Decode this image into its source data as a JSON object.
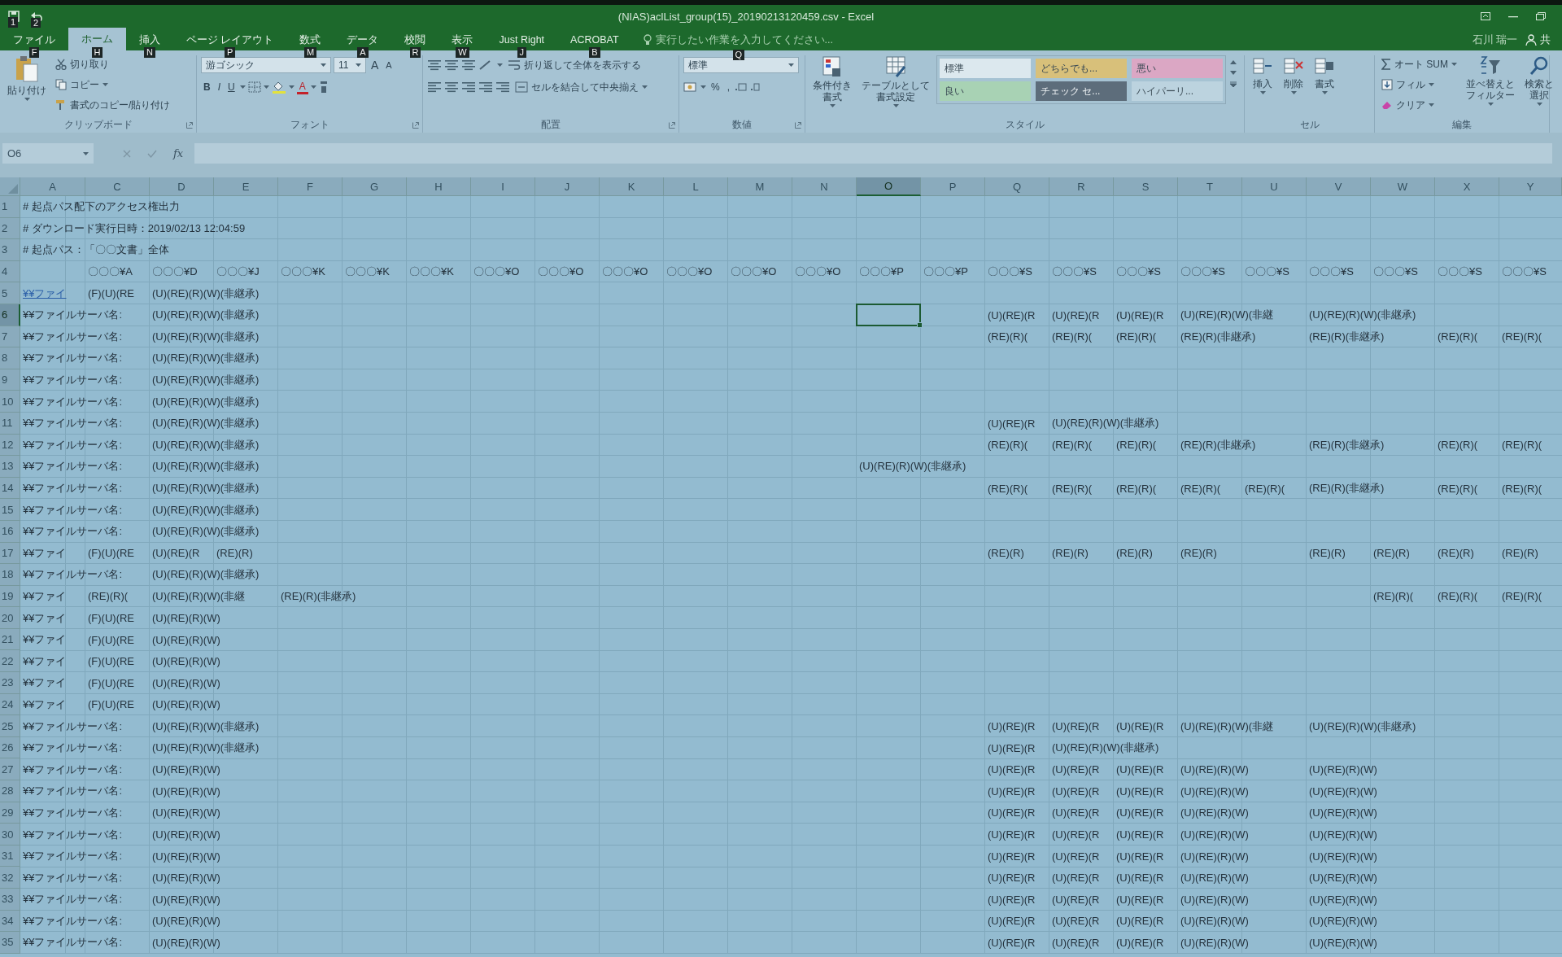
{
  "window": {
    "title": "(NIAS)aclList_group(15)_20190213120459.csv - Excel",
    "quick_access_keytips": [
      "1",
      "2"
    ]
  },
  "ribbon_tabs": [
    {
      "label": "ファイル",
      "keytip": "F",
      "selected": false
    },
    {
      "label": "ホーム",
      "keytip": "H",
      "selected": true
    },
    {
      "label": "挿入",
      "keytip": "N",
      "selected": false
    },
    {
      "label": "ページ レイアウト",
      "keytip": "P",
      "selected": false
    },
    {
      "label": "数式",
      "keytip": "M",
      "selected": false
    },
    {
      "label": "データ",
      "keytip": "A",
      "selected": false
    },
    {
      "label": "校閲",
      "keytip": "R",
      "selected": false
    },
    {
      "label": "表示",
      "keytip": "W",
      "selected": false
    },
    {
      "label": "Just Right",
      "keytip": "J",
      "selected": false
    },
    {
      "label": "ACROBAT",
      "keytip": "B",
      "selected": false
    }
  ],
  "tell_me": {
    "placeholder": "実行したい作業を入力してください...",
    "keytip": "Q"
  },
  "account": {
    "user": "石川 瑞一",
    "share": "共"
  },
  "ribbon_groups": [
    {
      "kind": "clipboard",
      "label": "クリップボード",
      "paste": "貼り付け",
      "cut": "切り取り",
      "copy": "コピー",
      "format_painter": "書式のコピー/貼り付け"
    },
    {
      "kind": "font",
      "label": "フォント",
      "font": "游ゴシック",
      "size": "11",
      "grow": "A",
      "shrink": "A",
      "bold": "B",
      "italic": "I",
      "underline": "U",
      "font_color": "A"
    },
    {
      "kind": "alignment",
      "label": "配置",
      "wrap": "折り返して全体を表示する",
      "merge": "セルを結合して中央揃え"
    },
    {
      "kind": "number",
      "label": "数値",
      "format": "標準",
      "percent": "%",
      "comma": ","
    },
    {
      "kind": "styles",
      "label": "スタイル",
      "conditional": [
        "条件付き",
        "書式"
      ],
      "as_table": [
        "テーブルとして",
        "書式設定"
      ],
      "cell_styles": [
        {
          "label": "標準",
          "color": "#dce8ee"
        },
        {
          "label": "どちらでも...",
          "color": "#d8c07a"
        },
        {
          "label": "悪い",
          "color": "#dba7c4"
        },
        {
          "label": "良い",
          "color": "#a8d2b4"
        },
        {
          "label": "チェック セ...",
          "color": "#5d6d7b"
        },
        {
          "label": "ハイパーリ...",
          "color": "#bcd3df"
        }
      ]
    },
    {
      "kind": "cells",
      "label": "セル",
      "insert": "挿入",
      "delete": "削除",
      "format": "書式"
    },
    {
      "kind": "editing",
      "label": "編集",
      "autosum": "オート SUM",
      "fill": "フィル",
      "clear": "クリア",
      "sort": [
        "並べ替えと",
        "フィルター"
      ],
      "find": [
        "検索と",
        "選択"
      ]
    }
  ],
  "formula_bar": {
    "name_box": "O6",
    "function_label": "fx"
  },
  "columns": [
    {
      "label": "A",
      "selected": false
    },
    {
      "label": "C",
      "selected": false
    },
    {
      "label": "D",
      "selected": false
    },
    {
      "label": "E",
      "selected": false
    },
    {
      "label": "F",
      "selected": false
    },
    {
      "label": "G",
      "selected": false
    },
    {
      "label": "H",
      "selected": false
    },
    {
      "label": "I",
      "selected": false
    },
    {
      "label": "J",
      "selected": false
    },
    {
      "label": "K",
      "selected": false
    },
    {
      "label": "L",
      "selected": false
    },
    {
      "label": "M",
      "selected": false
    },
    {
      "label": "N",
      "selected": false
    },
    {
      "label": "O",
      "selected": true
    },
    {
      "label": "P",
      "selected": false
    },
    {
      "label": "Q",
      "selected": false
    },
    {
      "label": "R",
      "selected": false
    },
    {
      "label": "S",
      "selected": false
    },
    {
      "label": "T",
      "selected": false
    },
    {
      "label": "U",
      "selected": false
    },
    {
      "label": "V",
      "selected": false
    },
    {
      "label": "W",
      "selected": false
    },
    {
      "label": "X",
      "selected": false
    },
    {
      "label": "Y",
      "selected": false
    }
  ],
  "rows": [
    {
      "number": "1",
      "selected": false,
      "cells": {
        "A": "# 起点パス配下のアクセス権出力"
      }
    },
    {
      "number": "2",
      "selected": false,
      "cells": {
        "A": "# ダウンロード実行日時：2019/02/13 12:04:59"
      }
    },
    {
      "number": "3",
      "selected": false,
      "cells": {
        "A": "# 起点パス：「〇〇文書」全体"
      }
    },
    {
      "number": "4",
      "selected": false,
      "cells": {
        "C": "〇〇〇¥A",
        "D": "〇〇〇¥D",
        "E": "〇〇〇¥J",
        "F": "〇〇〇¥K",
        "G": "〇〇〇¥K",
        "H": "〇〇〇¥K",
        "I": "〇〇〇¥O",
        "J": "〇〇〇¥O",
        "K": "〇〇〇¥O",
        "L": "〇〇〇¥O",
        "M": "〇〇〇¥O",
        "N": "〇〇〇¥O",
        "O": "〇〇〇¥P",
        "P": "〇〇〇¥P",
        "Q": "〇〇〇¥S",
        "R": "〇〇〇¥S",
        "S": "〇〇〇¥S",
        "T": "〇〇〇¥S",
        "U": "〇〇〇¥S",
        "V": "〇〇〇¥S",
        "W": "〇〇〇¥S",
        "X": "〇〇〇¥S",
        "Y": "〇〇〇¥S"
      }
    },
    {
      "number": "5",
      "selected": false,
      "link": true,
      "cells": {
        "A": "¥¥ファイ",
        "C": "(F)(U)(RE",
        "D": "(U)(RE)(R)(W)(非継承)"
      }
    },
    {
      "number": "6",
      "selected": true,
      "cells": {
        "A": "¥¥ファイルサーバ名:",
        "D": "(U)(RE)(R)(W)(非継承)",
        "Q": "(U)(RE)(R",
        "R": "(U)(RE)(R",
        "S": "(U)(RE)(R",
        "T": "(U)(RE)(R)(W)(非継",
        "V": "(U)(RE)(R)(W)(非継承)"
      }
    },
    {
      "number": "7",
      "selected": false,
      "cells": {
        "A": "¥¥ファイルサーバ名:",
        "D": "(U)(RE)(R)(W)(非継承)",
        "Q": "(RE)(R)(",
        "R": "(RE)(R)(",
        "S": "(RE)(R)(",
        "T": "(RE)(R)(非継承)",
        "V": "(RE)(R)(非継承)",
        "X": "(RE)(R)(",
        "Y": "(RE)(R)("
      }
    },
    {
      "number": "8",
      "selected": false,
      "cells": {
        "A": "¥¥ファイルサーバ名:",
        "D": "(U)(RE)(R)(W)(非継承)"
      }
    },
    {
      "number": "9",
      "selected": false,
      "cells": {
        "A": "¥¥ファイルサーバ名:",
        "D": "(U)(RE)(R)(W)(非継承)"
      }
    },
    {
      "number": "10",
      "selected": false,
      "cells": {
        "A": "¥¥ファイルサーバ名:",
        "D": "(U)(RE)(R)(W)(非継承)"
      }
    },
    {
      "number": "11",
      "selected": false,
      "cells": {
        "A": "¥¥ファイルサーバ名:",
        "D": "(U)(RE)(R)(W)(非継承)",
        "Q": "(U)(RE)(R",
        "R": "(U)(RE)(R)(W)(非継承)"
      }
    },
    {
      "number": "12",
      "selected": false,
      "cells": {
        "A": "¥¥ファイルサーバ名:",
        "D": "(U)(RE)(R)(W)(非継承)",
        "Q": "(RE)(R)(",
        "R": "(RE)(R)(",
        "S": "(RE)(R)(",
        "T": "(RE)(R)(非継承)",
        "V": "(RE)(R)(非継承)",
        "X": "(RE)(R)(",
        "Y": "(RE)(R)("
      }
    },
    {
      "number": "13",
      "selected": false,
      "cells": {
        "A": "¥¥ファイルサーバ名:",
        "D": "(U)(RE)(R)(W)(非継承)",
        "O": "(U)(RE)(R)(W)(非継承)"
      }
    },
    {
      "number": "14",
      "selected": false,
      "cells": {
        "A": "¥¥ファイルサーバ名:",
        "D": "(U)(RE)(R)(W)(非継承)",
        "Q": "(RE)(R)(",
        "R": "(RE)(R)(",
        "S": "(RE)(R)(",
        "T": "(RE)(R)(",
        "U": "(RE)(R)(",
        "V": "(RE)(R)(非継承)",
        "X": "(RE)(R)(",
        "Y": "(RE)(R)("
      }
    },
    {
      "number": "15",
      "selected": false,
      "cells": {
        "A": "¥¥ファイルサーバ名:",
        "D": "(U)(RE)(R)(W)(非継承)"
      }
    },
    {
      "number": "16",
      "selected": false,
      "cells": {
        "A": "¥¥ファイルサーバ名:",
        "D": "(U)(RE)(R)(W)(非継承)"
      }
    },
    {
      "number": "17",
      "selected": false,
      "cells": {
        "A": "¥¥ファイ",
        "C": "(F)(U)(RE",
        "D": "(U)(RE)(R",
        "E": "(RE)(R)",
        "Q": "(RE)(R)",
        "R": "(RE)(R)",
        "S": "(RE)(R)",
        "T": "(RE)(R)",
        "V": "(RE)(R)",
        "W": "(RE)(R)",
        "X": "(RE)(R)",
        "Y": "(RE)(R)"
      }
    },
    {
      "number": "18",
      "selected": false,
      "cells": {
        "A": "¥¥ファイルサーバ名:",
        "D": "(U)(RE)(R)(W)(非継承)"
      }
    },
    {
      "number": "19",
      "selected": false,
      "cells": {
        "A": "¥¥ファイ",
        "C": "(RE)(R)(",
        "D": "(U)(RE)(R)(W)(非継",
        "F": "(RE)(R)(非継承)",
        "W": "(RE)(R)(",
        "X": "(RE)(R)(",
        "Y": "(RE)(R)("
      }
    },
    {
      "number": "20",
      "selected": false,
      "cells": {
        "A": "¥¥ファイ",
        "C": "(F)(U)(RE",
        "D": "(U)(RE)(R)(W)"
      }
    },
    {
      "number": "21",
      "selected": false,
      "cells": {
        "A": "¥¥ファイ",
        "C": "(F)(U)(RE",
        "D": "(U)(RE)(R)(W)"
      }
    },
    {
      "number": "22",
      "selected": false,
      "cells": {
        "A": "¥¥ファイ",
        "C": "(F)(U)(RE",
        "D": "(U)(RE)(R)(W)"
      }
    },
    {
      "number": "23",
      "selected": false,
      "cells": {
        "A": "¥¥ファイ",
        "C": "(F)(U)(RE",
        "D": "(U)(RE)(R)(W)"
      }
    },
    {
      "number": "24",
      "selected": false,
      "cells": {
        "A": "¥¥ファイ",
        "C": "(F)(U)(RE",
        "D": "(U)(RE)(R)(W)"
      }
    },
    {
      "number": "25",
      "selected": false,
      "cells": {
        "A": "¥¥ファイルサーバ名:",
        "D": "(U)(RE)(R)(W)(非継承)",
        "Q": "(U)(RE)(R",
        "R": "(U)(RE)(R",
        "S": "(U)(RE)(R",
        "T": "(U)(RE)(R)(W)(非継",
        "V": "(U)(RE)(R)(W)(非継承)"
      }
    },
    {
      "number": "26",
      "selected": false,
      "cells": {
        "A": "¥¥ファイルサーバ名:",
        "D": "(U)(RE)(R)(W)(非継承)",
        "Q": "(U)(RE)(R",
        "R": "(U)(RE)(R)(W)(非継承)"
      }
    },
    {
      "number": "27",
      "selected": false,
      "cells": {
        "A": "¥¥ファイルサーバ名:",
        "D": "(U)(RE)(R)(W)",
        "Q": "(U)(RE)(R",
        "R": "(U)(RE)(R",
        "S": "(U)(RE)(R",
        "T": "(U)(RE)(R)(W)",
        "V": "(U)(RE)(R)(W)"
      }
    },
    {
      "number": "28",
      "selected": false,
      "cells": {
        "A": "¥¥ファイルサーバ名:",
        "D": "(U)(RE)(R)(W)",
        "Q": "(U)(RE)(R",
        "R": "(U)(RE)(R",
        "S": "(U)(RE)(R",
        "T": "(U)(RE)(R)(W)",
        "V": "(U)(RE)(R)(W)"
      }
    },
    {
      "number": "29",
      "selected": false,
      "cells": {
        "A": "¥¥ファイルサーバ名:",
        "D": "(U)(RE)(R)(W)",
        "Q": "(U)(RE)(R",
        "R": "(U)(RE)(R",
        "S": "(U)(RE)(R",
        "T": "(U)(RE)(R)(W)",
        "V": "(U)(RE)(R)(W)"
      }
    },
    {
      "number": "30",
      "selected": false,
      "cells": {
        "A": "¥¥ファイルサーバ名:",
        "D": "(U)(RE)(R)(W)",
        "Q": "(U)(RE)(R",
        "R": "(U)(RE)(R",
        "S": "(U)(RE)(R",
        "T": "(U)(RE)(R)(W)",
        "V": "(U)(RE)(R)(W)"
      }
    },
    {
      "number": "31",
      "selected": false,
      "cells": {
        "A": "¥¥ファイルサーバ名:",
        "D": "(U)(RE)(R)(W)",
        "Q": "(U)(RE)(R",
        "R": "(U)(RE)(R",
        "S": "(U)(RE)(R",
        "T": "(U)(RE)(R)(W)",
        "V": "(U)(RE)(R)(W)"
      }
    },
    {
      "number": "32",
      "selected": false,
      "cells": {
        "A": "¥¥ファイルサーバ名:",
        "D": "(U)(RE)(R)(W)",
        "Q": "(U)(RE)(R",
        "R": "(U)(RE)(R",
        "S": "(U)(RE)(R",
        "T": "(U)(RE)(R)(W)",
        "V": "(U)(RE)(R)(W)"
      }
    },
    {
      "number": "33",
      "selected": false,
      "cells": {
        "A": "¥¥ファイルサーバ名:",
        "D": "(U)(RE)(R)(W)",
        "Q": "(U)(RE)(R",
        "R": "(U)(RE)(R",
        "S": "(U)(RE)(R",
        "T": "(U)(RE)(R)(W)",
        "V": "(U)(RE)(R)(W)"
      }
    },
    {
      "number": "34",
      "selected": false,
      "cells": {
        "A": "¥¥ファイルサーバ名:",
        "D": "(U)(RE)(R)(W)",
        "Q": "(U)(RE)(R",
        "R": "(U)(RE)(R",
        "S": "(U)(RE)(R",
        "T": "(U)(RE)(R)(W)",
        "V": "(U)(RE)(R)(W)"
      }
    },
    {
      "number": "35",
      "selected": false,
      "cells": {
        "A": "¥¥ファイルサーバ名:",
        "D": "(U)(RE)(R)(W)",
        "Q": "(U)(RE)(R",
        "R": "(U)(RE)(R",
        "S": "(U)(RE)(R",
        "T": "(U)(RE)(R)(W)",
        "V": "(U)(RE)(R)(W)"
      }
    }
  ]
}
